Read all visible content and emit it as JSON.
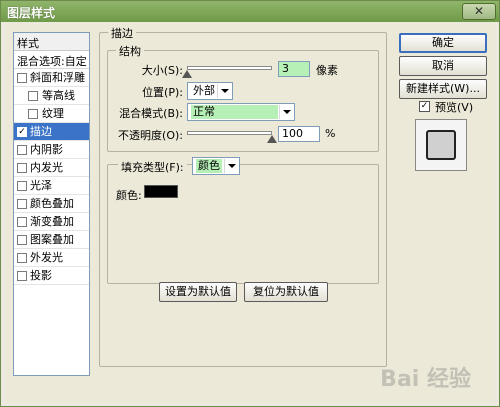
{
  "window": {
    "title": "图层样式",
    "close_glyph": "✕"
  },
  "sidebar": {
    "header": "样式",
    "blend_options": "混合选项:自定",
    "items": [
      {
        "label": "斜面和浮雕",
        "checked": false,
        "sub": false
      },
      {
        "label": "等高线",
        "checked": false,
        "sub": true
      },
      {
        "label": "纹理",
        "checked": false,
        "sub": true
      },
      {
        "label": "描边",
        "checked": true,
        "sub": false,
        "selected": true
      },
      {
        "label": "内阴影",
        "checked": false,
        "sub": false
      },
      {
        "label": "内发光",
        "checked": false,
        "sub": false
      },
      {
        "label": "光泽",
        "checked": false,
        "sub": false
      },
      {
        "label": "颜色叠加",
        "checked": false,
        "sub": false
      },
      {
        "label": "渐变叠加",
        "checked": false,
        "sub": false
      },
      {
        "label": "图案叠加",
        "checked": false,
        "sub": false
      },
      {
        "label": "外发光",
        "checked": false,
        "sub": false
      },
      {
        "label": "投影",
        "checked": false,
        "sub": false
      }
    ],
    "check_glyph": "✓"
  },
  "stroke": {
    "section_title": "描边",
    "structure_title": "结构",
    "size_label": "大小(S):",
    "size_value": "3",
    "size_unit": "像素",
    "position_label": "位置(P):",
    "position_value": "外部",
    "blend_label": "混合模式(B):",
    "blend_value": "正常",
    "opacity_label": "不透明度(O):",
    "opacity_value": "100",
    "opacity_unit": "%",
    "fill_type_label": "填充类型(F):",
    "fill_type_value": "颜色",
    "color_label": "颜色:",
    "color_value": "#000000",
    "size_slider_fraction": 0.0,
    "opacity_slider_fraction": 1.0
  },
  "buttons": {
    "set_default": "设置为默认值",
    "reset_default": "复位为默认值",
    "ok": "确定",
    "cancel": "取消",
    "new_style": "新建样式(W)...",
    "preview_label": "预览(V)",
    "preview_checked": true
  },
  "watermark": "Bai 经验"
}
